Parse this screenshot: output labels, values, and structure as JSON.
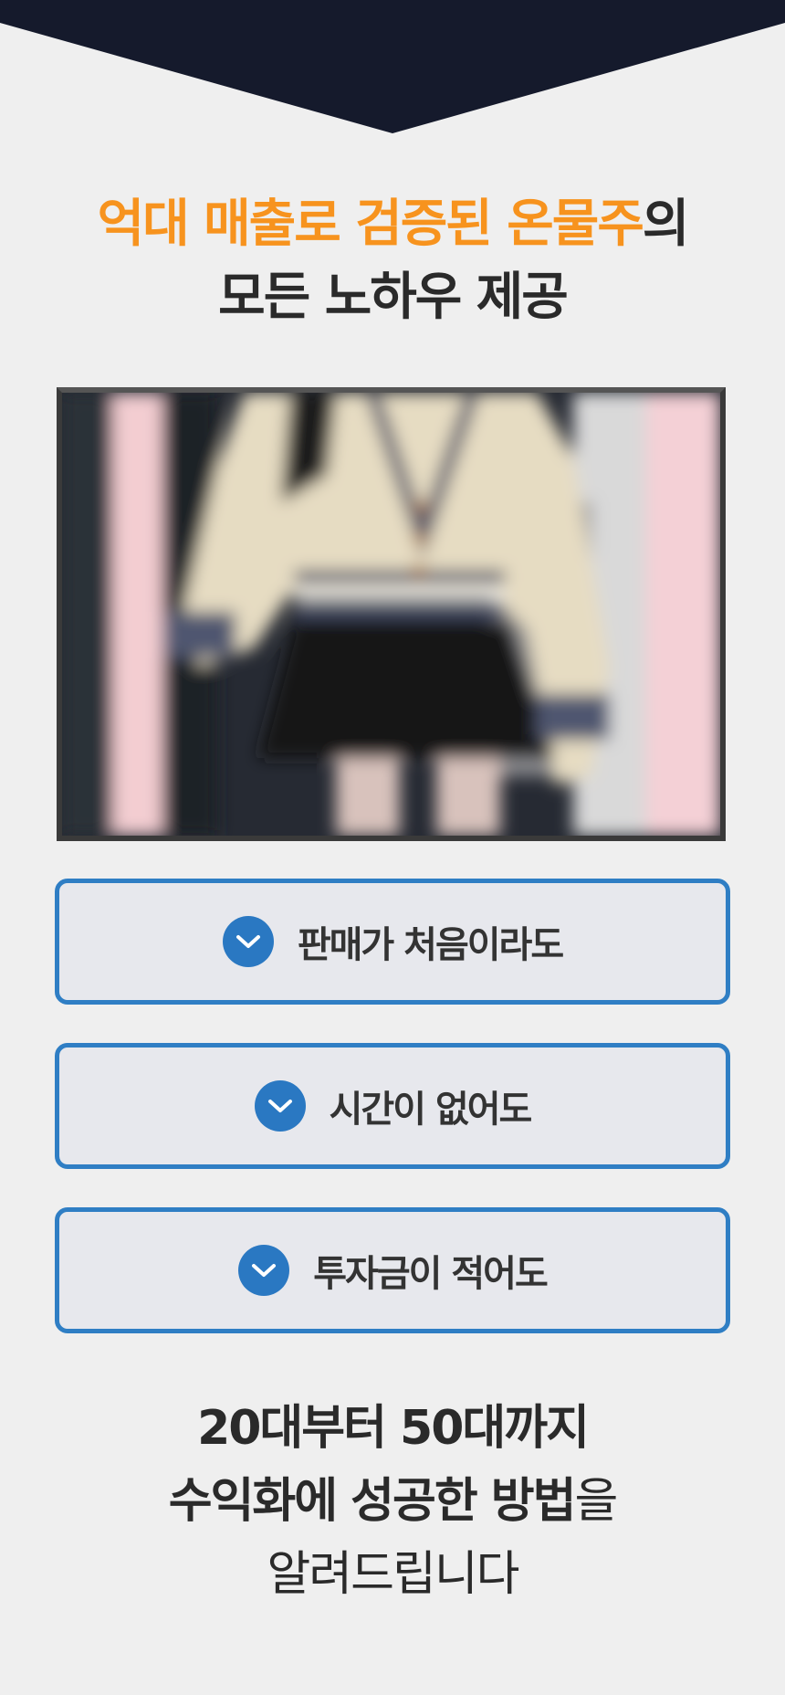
{
  "headline": {
    "line1_accent": "억대 매출로 검증된 온물주",
    "line1_rest": "의",
    "line2": "모든 노하우 제공"
  },
  "colors": {
    "accent": "#f7931e",
    "navy": "#151a2c",
    "feature_border": "#2f7ec4",
    "check_circle": "#2a78c2"
  },
  "features": [
    {
      "label": "판매가 처음이라도",
      "icon": "check-chevron-icon"
    },
    {
      "label": "시간이 없어도",
      "icon": "check-chevron-icon"
    },
    {
      "label": "투자금이 적어도",
      "icon": "check-chevron-icon"
    }
  ],
  "closing": {
    "line1": "20대부터 50대까지",
    "line2_bold": "수익화에 성공한 방법",
    "line2_rest": "을",
    "line3": "알려드립니다"
  }
}
